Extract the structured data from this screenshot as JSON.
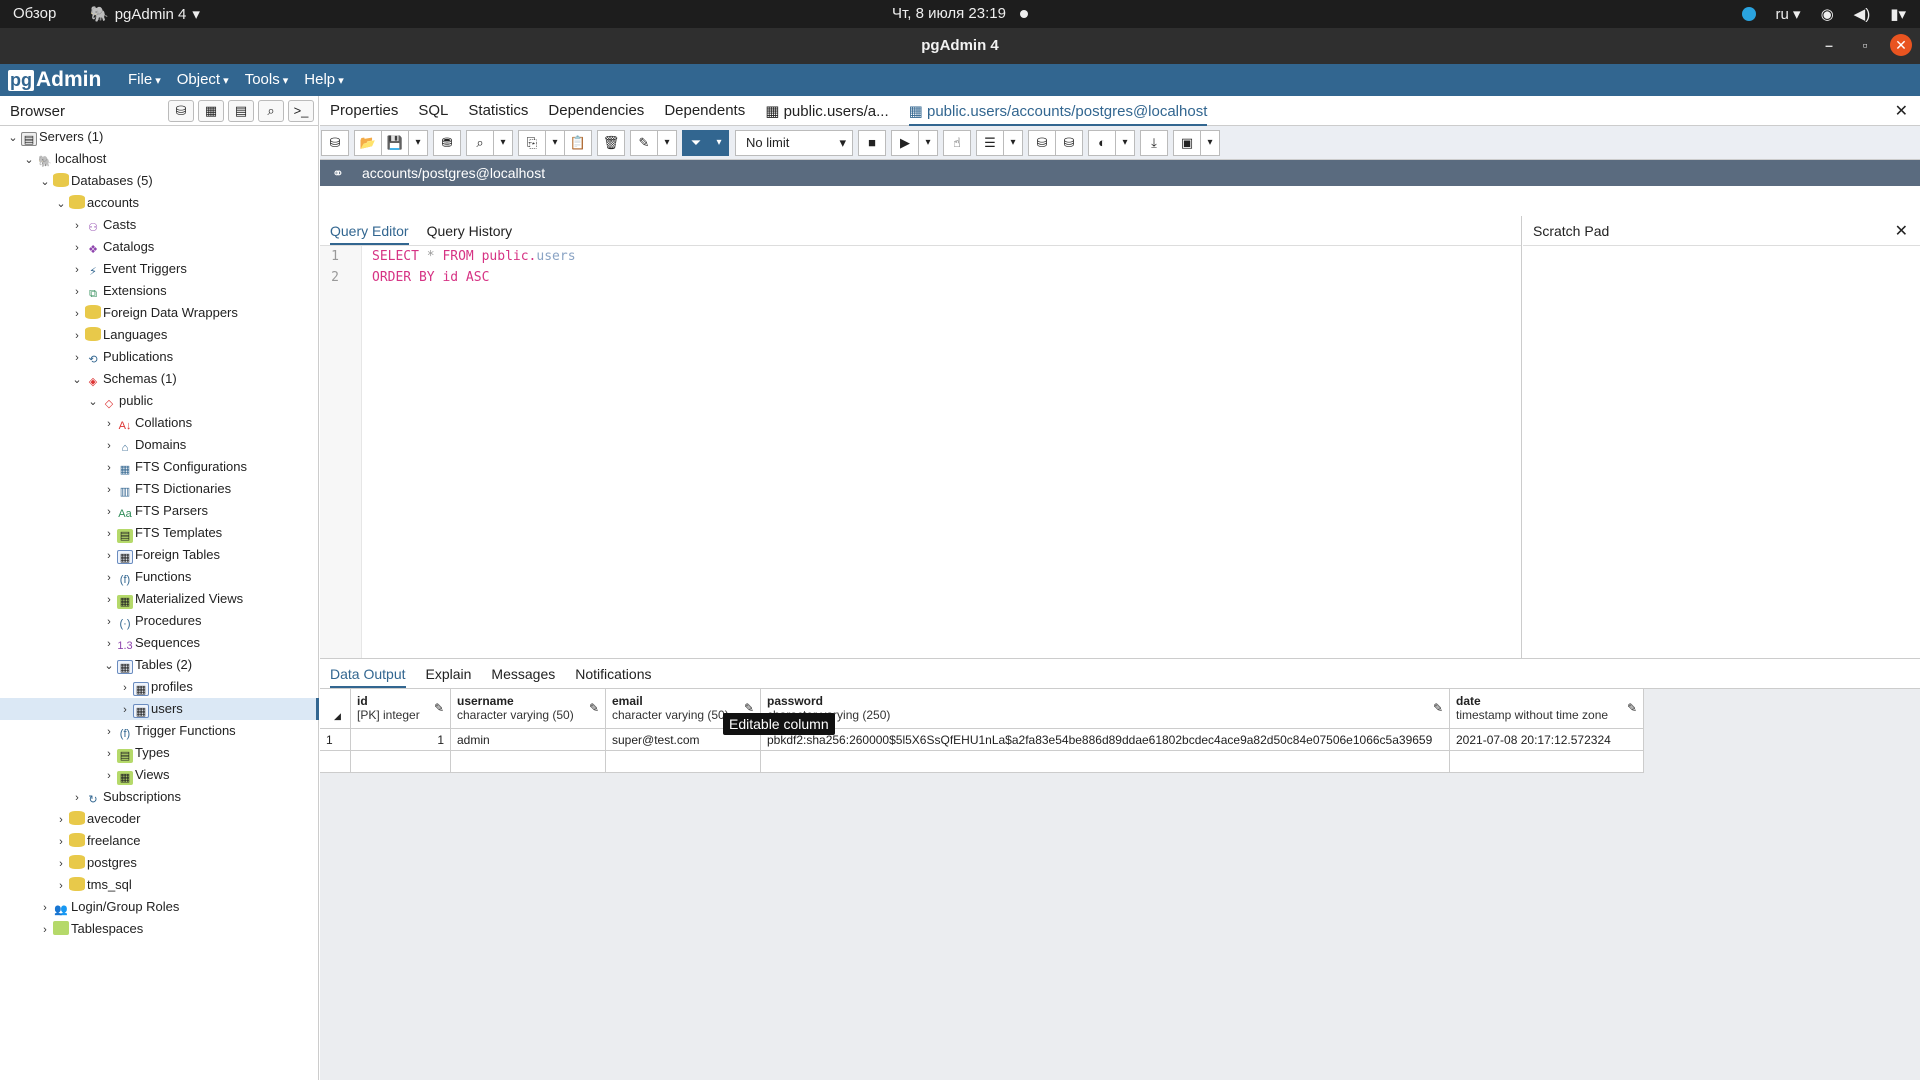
{
  "gnome": {
    "activities": "Обзор",
    "app": "pgAdmin 4",
    "clock": "Чт, 8 июля  23:19",
    "lang": "ru"
  },
  "window": {
    "title": "pgAdmin 4"
  },
  "menubar": {
    "logo_pg": "pg",
    "logo_rest": "Admin",
    "menus": [
      "File",
      "Object",
      "Tools",
      "Help"
    ]
  },
  "browser": {
    "title": "Browser",
    "tree": [
      {
        "label": "Servers (1)",
        "toggle": "⌄",
        "icon": "▤",
        "cls": "srv"
      },
      {
        "label": "localhost",
        "toggle": "⌄",
        "icon": "🐘",
        "cls": "blue"
      },
      {
        "label": "Databases (5)",
        "toggle": "⌄",
        "icon": "",
        "cls": "db"
      },
      {
        "label": "accounts",
        "toggle": "⌄",
        "icon": "",
        "cls": "db"
      },
      {
        "label": "Casts",
        "toggle": "›",
        "icon": "⚇",
        "cls": "purple"
      },
      {
        "label": "Catalogs",
        "toggle": "›",
        "icon": "❖",
        "cls": "purple"
      },
      {
        "label": "Event Triggers",
        "toggle": "›",
        "icon": "⚡",
        "cls": "blue"
      },
      {
        "label": "Extensions",
        "toggle": "›",
        "icon": "⧉",
        "cls": "green"
      },
      {
        "label": "Foreign Data Wrappers",
        "toggle": "›",
        "icon": "",
        "cls": "db"
      },
      {
        "label": "Languages",
        "toggle": "›",
        "icon": "",
        "cls": "db"
      },
      {
        "label": "Publications",
        "toggle": "›",
        "icon": "⟲",
        "cls": "blue"
      },
      {
        "label": "Schemas (1)",
        "toggle": "⌄",
        "icon": "◈",
        "cls": "red"
      },
      {
        "label": "public",
        "toggle": "⌄",
        "icon": "◇",
        "cls": "red"
      },
      {
        "label": "Collations",
        "toggle": "›",
        "icon": "A↓",
        "cls": "red"
      },
      {
        "label": "Domains",
        "toggle": "›",
        "icon": "⌂",
        "cls": "blue"
      },
      {
        "label": "FTS Configurations",
        "toggle": "›",
        "icon": "▦",
        "cls": "blue"
      },
      {
        "label": "FTS Dictionaries",
        "toggle": "›",
        "icon": "▥",
        "cls": "blue"
      },
      {
        "label": "FTS Parsers",
        "toggle": "›",
        "icon": "Aa",
        "cls": "green"
      },
      {
        "label": "FTS Templates",
        "toggle": "›",
        "icon": "▤",
        "cls": "fld"
      },
      {
        "label": "Foreign Tables",
        "toggle": "›",
        "icon": "▦",
        "cls": "tbl"
      },
      {
        "label": "Functions",
        "toggle": "›",
        "icon": "(f)",
        "cls": "blue"
      },
      {
        "label": "Materialized Views",
        "toggle": "›",
        "icon": "▦",
        "cls": "fld"
      },
      {
        "label": "Procedures",
        "toggle": "›",
        "icon": "(·)",
        "cls": "blue"
      },
      {
        "label": "Sequences",
        "toggle": "›",
        "icon": "1.3",
        "cls": "purple"
      },
      {
        "label": "Tables (2)",
        "toggle": "⌄",
        "icon": "▦",
        "cls": "tbl"
      },
      {
        "label": "profiles",
        "toggle": "›",
        "icon": "▦",
        "cls": "tbl"
      },
      {
        "label": "users",
        "toggle": "›",
        "icon": "▦",
        "cls": "tbl",
        "selected": true
      },
      {
        "label": "Trigger Functions",
        "toggle": "›",
        "icon": "(f)",
        "cls": "blue"
      },
      {
        "label": "Types",
        "toggle": "›",
        "icon": "▤",
        "cls": "fld"
      },
      {
        "label": "Views",
        "toggle": "›",
        "icon": "▦",
        "cls": "fld"
      },
      {
        "label": "Subscriptions",
        "toggle": "›",
        "icon": "↻",
        "cls": "blue"
      },
      {
        "label": "avecoder",
        "toggle": "›",
        "icon": "",
        "cls": "db"
      },
      {
        "label": "freelance",
        "toggle": "›",
        "icon": "",
        "cls": "db"
      },
      {
        "label": "postgres",
        "toggle": "›",
        "icon": "",
        "cls": "db"
      },
      {
        "label": "tms_sql",
        "toggle": "›",
        "icon": "",
        "cls": "db"
      },
      {
        "label": "Login/Group Roles",
        "toggle": "›",
        "icon": "👥",
        "cls": "red"
      },
      {
        "label": "Tablespaces",
        "toggle": "›",
        "icon": "",
        "cls": "fld"
      }
    ]
  },
  "tabs": {
    "properties": "Properties",
    "sql": "SQL",
    "statistics": "Statistics",
    "dependencies": "Dependencies",
    "dependents": "Dependents",
    "tab_users_short": "public.users/a...",
    "tab_users_active": "public.users/accounts/postgres@localhost"
  },
  "toolbar": {
    "limit": "No limit"
  },
  "connection": {
    "label": "accounts/postgres@localhost"
  },
  "editor": {
    "tab_query": "Query Editor",
    "tab_history": "Query History",
    "scratch": "Scratch Pad",
    "line_numbers": [
      "1",
      "2"
    ],
    "line1": {
      "kw1": "SELECT",
      "op": "*",
      "kw2": "FROM",
      "schema": "public.",
      "table": "users"
    },
    "line2": {
      "kw": "ORDER BY",
      "rest": "id ASC"
    }
  },
  "output": {
    "tabs": [
      "Data Output",
      "Explain",
      "Messages",
      "Notifications"
    ],
    "columns": [
      {
        "name": "id",
        "type": "[PK] integer"
      },
      {
        "name": "username",
        "type": "character varying (50)"
      },
      {
        "name": "email",
        "type": "character varying (50)"
      },
      {
        "name": "password",
        "type": "character varying (250)"
      },
      {
        "name": "date",
        "type": "timestamp without time zone"
      }
    ],
    "rows": [
      {
        "row": "1",
        "id": "1",
        "username": "admin",
        "email": "super@test.com",
        "password": "pbkdf2:sha256:260000$5l5X6SsQfEHU1nLa$a2fa83e54be886d89ddae61802bcdec4ace9a82d50c84e07506e1066c5a39659",
        "date": "2021-07-08 20:17:12.572324"
      }
    ],
    "tooltip": "Editable column"
  }
}
